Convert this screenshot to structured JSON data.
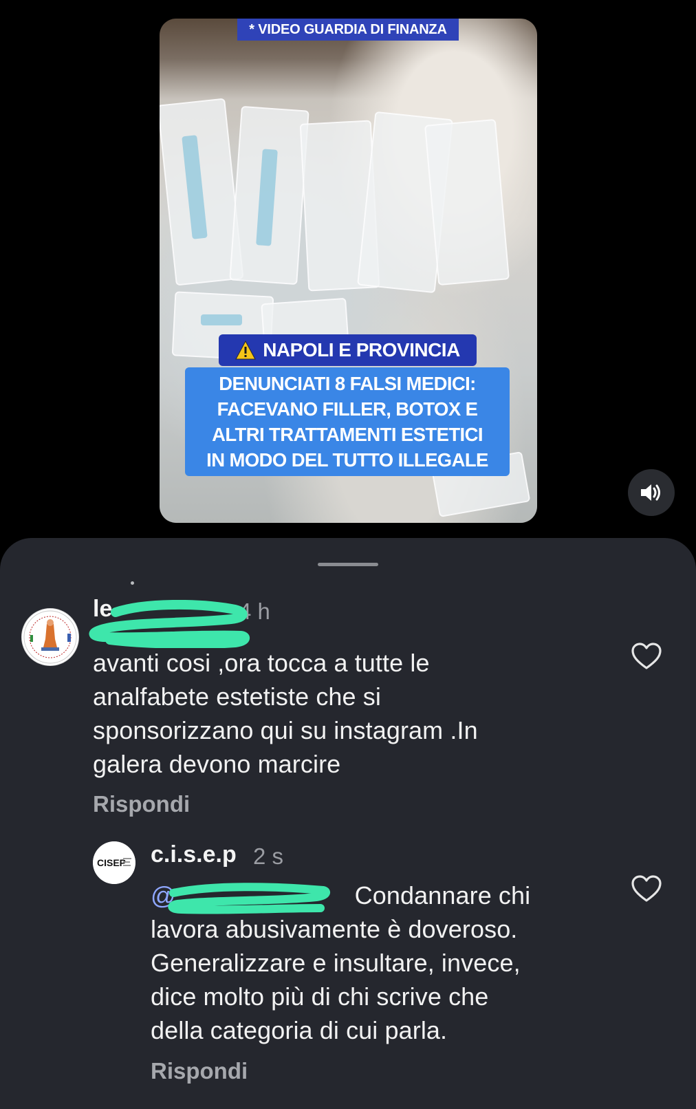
{
  "video": {
    "source_caption": "* VIDEO GUARDIA DI FINANZA",
    "location_banner": "NAPOLI E PROVINCIA",
    "headline": "DENUNCIATI 8 FALSI MEDICI:\nFACEVANO FILLER, BOTOX E\nALTRI TRATTAMENTI ESTETICI\nIN MODO DEL TUTTO ILLEGALE",
    "warning_icon": "warning-triangle-icon",
    "sound_icon": "speaker-icon"
  },
  "comments": [
    {
      "username": "le",
      "time": "4 h",
      "text": "avanti cosi ,ora tocca a tutte le\nanalfabete estetiste che si\nsponsorizzano qui su instagram .In\ngalera devono marcire",
      "reply_label": "Rispondi"
    },
    {
      "username": "c.i.s.e.p",
      "time": "2 s",
      "mention": "@",
      "text_first_line": "Condannare chi",
      "text": "lavora abusivamente è doveroso.\nGeneralizzare e insultare, invece,\ndice molto più di chi scrive che\ndella categoria di cui parla.",
      "reply_label": "Rispondi",
      "avatar_text": "CISEP"
    }
  ],
  "colors": {
    "sheet_bg": "#25272e",
    "headline_bg": "#3a86e6",
    "banner_bg": "#2438b0",
    "mention": "#8fa7ff",
    "redaction": "#3ee6ab"
  }
}
